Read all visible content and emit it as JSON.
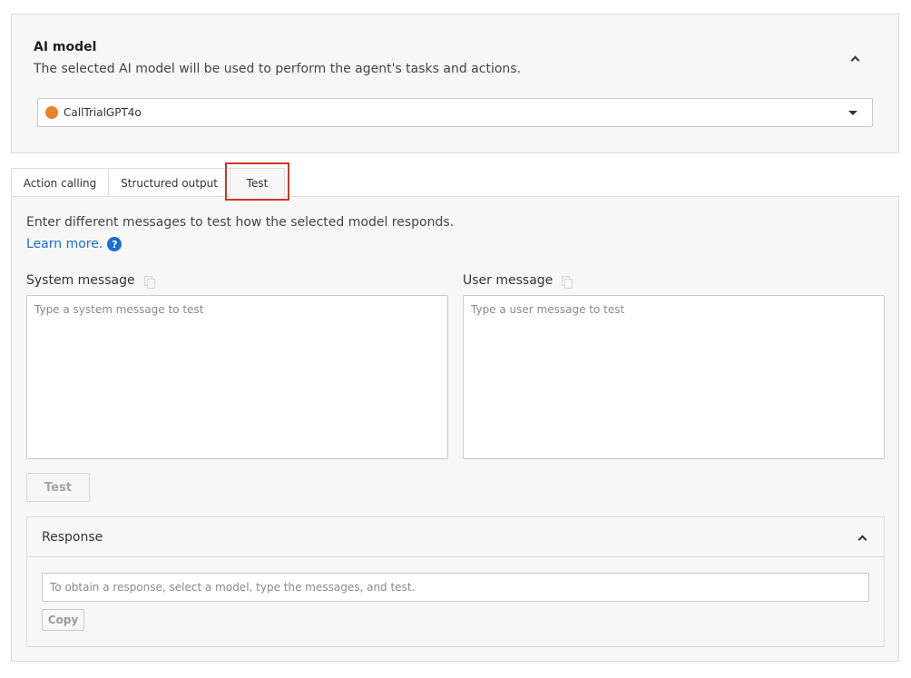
{
  "ai_model": {
    "title": "AI model",
    "description": "The selected AI model will be used to perform the agent's tasks and actions.",
    "selected_model": "CallTrialGPT4o",
    "model_dot_color": "#e8822a",
    "collapse_icon": "chevron-up-icon",
    "dropdown_icon": "caret-down-icon"
  },
  "tabs": [
    {
      "label": "Action calling",
      "active": false
    },
    {
      "label": "Structured output",
      "active": false
    },
    {
      "label": "Test",
      "active": true
    }
  ],
  "test": {
    "intro": "Enter different messages to test how the selected model responds.",
    "learn_more": "Learn more.",
    "help_icon": "?",
    "system_message": {
      "label": "System message",
      "placeholder": "Type a system message to test",
      "value": ""
    },
    "user_message": {
      "label": "User message",
      "placeholder": "Type a user message to test",
      "value": ""
    },
    "test_button": "Test"
  },
  "response": {
    "title": "Response",
    "placeholder": "To obtain a response, select a model, type the messages, and test.",
    "copy_button": "Copy"
  },
  "colors": {
    "highlight": "#c9381f",
    "link": "#1a6fcf"
  }
}
